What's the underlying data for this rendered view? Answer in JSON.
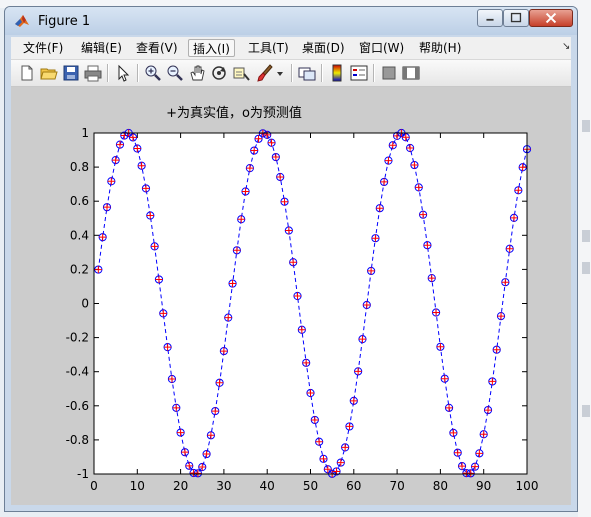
{
  "window": {
    "title": "Figure 1",
    "icon": "matlab-logo-icon"
  },
  "menu": {
    "items": [
      {
        "label": "文件(F)",
        "name": "menu-file"
      },
      {
        "label": "编辑(E)",
        "name": "menu-edit"
      },
      {
        "label": "查看(V)",
        "name": "menu-view"
      },
      {
        "label": "插入(I)",
        "name": "menu-insert"
      },
      {
        "label": "工具(T)",
        "name": "menu-tools"
      },
      {
        "label": "桌面(D)",
        "name": "menu-desktop"
      },
      {
        "label": "窗口(W)",
        "name": "menu-window"
      },
      {
        "label": "帮助(H)",
        "name": "menu-help"
      }
    ],
    "active_item": "插入(I)"
  },
  "toolbar": {
    "buttons": [
      "new-figure-icon",
      "open-folder-icon",
      "save-icon",
      "print-icon",
      "pointer-icon",
      "zoom-in-icon",
      "zoom-out-icon",
      "pan-hand-icon",
      "rotate-3d-icon",
      "data-cursor-icon",
      "brush-icon",
      "link-plot-icon",
      "colorbar-icon",
      "legend-icon",
      "hide-plot-tools-icon",
      "show-plot-tools-icon"
    ]
  },
  "colors": {
    "true_marker": "#ff0000",
    "predicted_marker": "#0000ff",
    "line": "#0000ff",
    "figure_bg": "#cccccc",
    "axes_bg": "#ffffff"
  },
  "chart_data": {
    "type": "line",
    "title": "+为真实值，o为预测值",
    "xlabel": "",
    "ylabel": "",
    "xlim": [
      0,
      100
    ],
    "ylim": [
      -1,
      1
    ],
    "xticks": [
      "0",
      "10",
      "20",
      "30",
      "40",
      "50",
      "60",
      "70",
      "80",
      "90",
      "100"
    ],
    "yticks": [
      "1",
      "0.8",
      "0.6",
      "0.4",
      "0.2",
      "0",
      "-0.2",
      "-0.4",
      "-0.6",
      "-0.8",
      "-1"
    ],
    "grid": false,
    "legend": "none",
    "x": [
      1,
      2,
      3,
      4,
      5,
      6,
      7,
      8,
      9,
      10,
      11,
      12,
      13,
      14,
      15,
      16,
      17,
      18,
      19,
      20,
      21,
      22,
      23,
      24,
      25,
      26,
      27,
      28,
      29,
      30,
      31,
      32,
      33,
      34,
      35,
      36,
      37,
      38,
      39,
      40,
      41,
      42,
      43,
      44,
      45,
      46,
      47,
      48,
      49,
      50,
      51,
      52,
      53,
      54,
      55,
      56,
      57,
      58,
      59,
      60,
      61,
      62,
      63,
      64,
      65,
      66,
      67,
      68,
      69,
      70,
      71,
      72,
      73,
      74,
      75,
      76,
      77,
      78,
      79,
      80,
      81,
      82,
      83,
      84,
      85,
      86,
      87,
      88,
      89,
      90,
      91,
      92,
      93,
      94,
      95,
      96,
      97,
      98,
      99,
      100
    ],
    "series": [
      {
        "marker": "+",
        "color": "#ff0000",
        "values": [
          0.199,
          0.389,
          0.565,
          0.717,
          0.841,
          0.932,
          0.985,
          1.0,
          0.974,
          0.909,
          0.808,
          0.675,
          0.516,
          0.335,
          0.141,
          -0.058,
          -0.256,
          -0.443,
          -0.612,
          -0.757,
          -0.872,
          -0.952,
          -0.994,
          -0.996,
          -0.959,
          -0.883,
          -0.773,
          -0.631,
          -0.465,
          -0.279,
          -0.083,
          0.117,
          0.312,
          0.494,
          0.657,
          0.794,
          0.897,
          0.966,
          0.998,
          0.989,
          0.943,
          0.859,
          0.742,
          0.597,
          0.428,
          0.242,
          0.044,
          -0.154,
          -0.348,
          -0.525,
          -0.683,
          -0.811,
          -0.911,
          -0.972,
          -0.999,
          -0.985,
          -0.933,
          -0.844,
          -0.721,
          -0.571,
          -0.398,
          -0.209,
          -0.009,
          0.191,
          0.383,
          0.559,
          0.713,
          0.838,
          0.928,
          0.983,
          1.0,
          0.975,
          0.912,
          0.812,
          0.681,
          0.521,
          0.342,
          0.149,
          -0.053,
          -0.254,
          -0.441,
          -0.612,
          -0.759,
          -0.875,
          -0.954,
          -0.995,
          -0.996,
          -0.957,
          -0.879,
          -0.767,
          -0.625,
          -0.457,
          -0.271,
          -0.074,
          0.125,
          0.321,
          0.502,
          0.664,
          0.799,
          0.905
        ]
      },
      {
        "marker": "o",
        "color": "#0000ff",
        "line": "--",
        "values": [
          0.199,
          0.389,
          0.565,
          0.717,
          0.841,
          0.932,
          0.985,
          1.0,
          0.974,
          0.909,
          0.808,
          0.675,
          0.516,
          0.335,
          0.141,
          -0.058,
          -0.256,
          -0.443,
          -0.612,
          -0.757,
          -0.872,
          -0.952,
          -0.994,
          -0.996,
          -0.959,
          -0.883,
          -0.773,
          -0.631,
          -0.465,
          -0.279,
          -0.083,
          0.117,
          0.312,
          0.494,
          0.657,
          0.794,
          0.897,
          0.966,
          0.998,
          0.989,
          0.943,
          0.859,
          0.742,
          0.597,
          0.428,
          0.242,
          0.044,
          -0.154,
          -0.348,
          -0.525,
          -0.683,
          -0.811,
          -0.911,
          -0.972,
          -0.999,
          -0.985,
          -0.933,
          -0.844,
          -0.721,
          -0.571,
          -0.398,
          -0.209,
          -0.009,
          0.191,
          0.383,
          0.559,
          0.713,
          0.838,
          0.928,
          0.983,
          1.0,
          0.975,
          0.912,
          0.812,
          0.681,
          0.521,
          0.342,
          0.149,
          -0.053,
          -0.254,
          -0.441,
          -0.612,
          -0.759,
          -0.875,
          -0.954,
          -0.995,
          -0.996,
          -0.957,
          -0.879,
          -0.767,
          -0.625,
          -0.457,
          -0.271,
          -0.074,
          0.125,
          0.321,
          0.502,
          0.664,
          0.799,
          0.905
        ]
      }
    ]
  }
}
